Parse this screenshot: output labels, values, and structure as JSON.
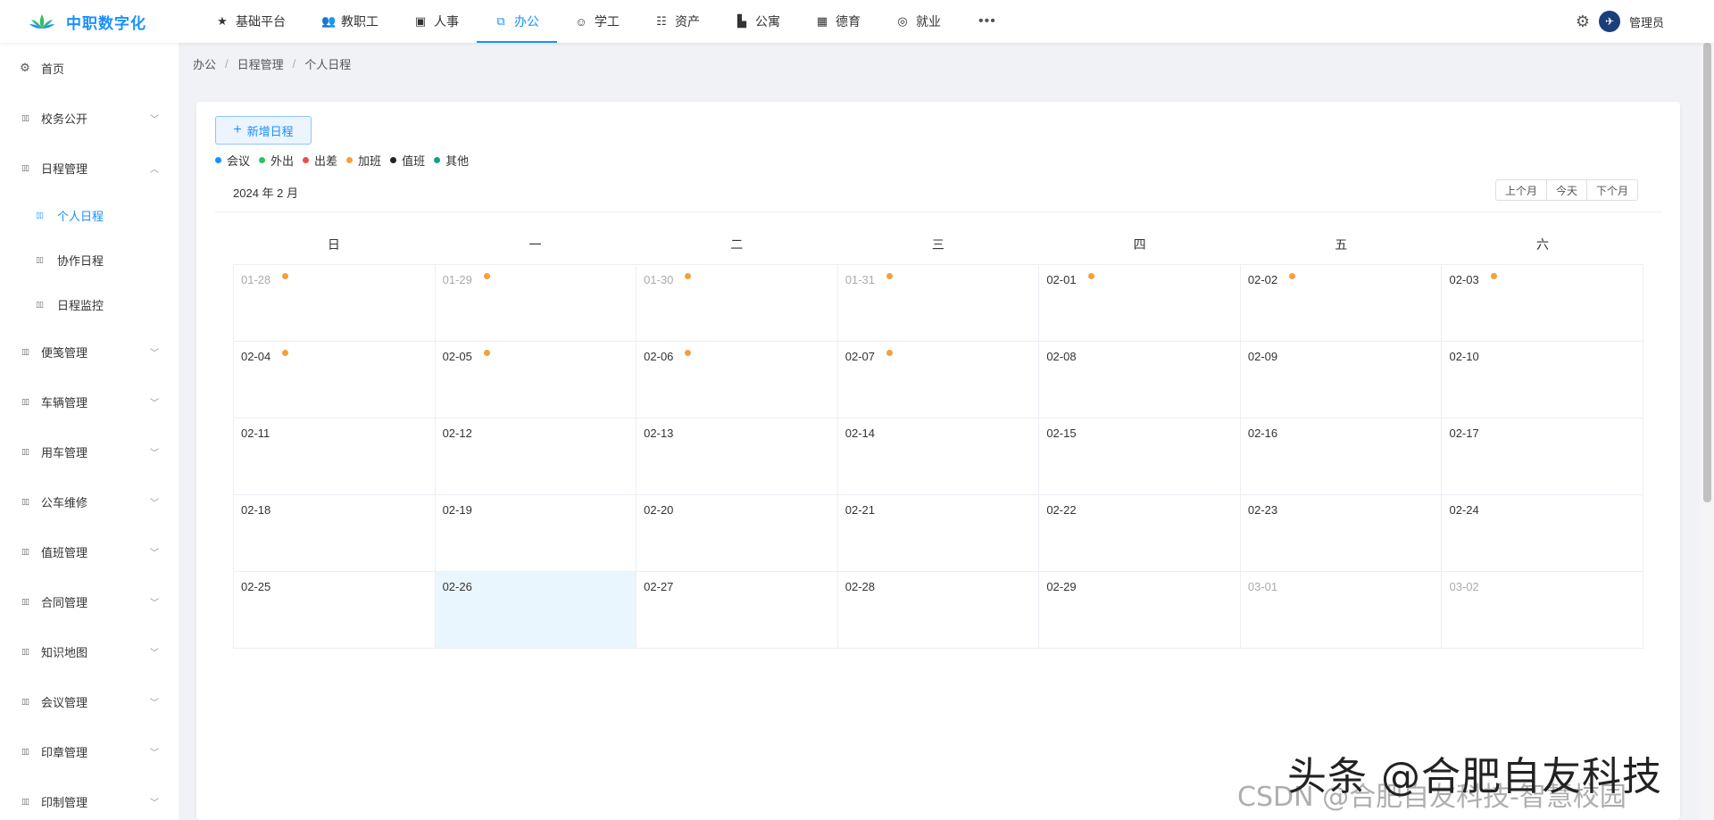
{
  "brand": {
    "name": "中职数字化"
  },
  "topnav": [
    {
      "label": "基础平台",
      "icon": "star-icon",
      "glyph": "★",
      "active": false
    },
    {
      "label": "教职工",
      "icon": "users-icon",
      "glyph": "👥",
      "active": false
    },
    {
      "label": "人事",
      "icon": "image-icon",
      "glyph": "▣",
      "active": false
    },
    {
      "label": "办公",
      "icon": "office-icon",
      "glyph": "⧉",
      "active": true
    },
    {
      "label": "学工",
      "icon": "student-icon",
      "glyph": "☺",
      "active": false
    },
    {
      "label": "资产",
      "icon": "asset-icon",
      "glyph": "☷",
      "active": false
    },
    {
      "label": "公寓",
      "icon": "apartment-icon",
      "glyph": "▙",
      "active": false
    },
    {
      "label": "德育",
      "icon": "calendar-grid-icon",
      "glyph": "▦",
      "active": false
    },
    {
      "label": "就业",
      "icon": "job-icon",
      "glyph": "◎",
      "active": false
    }
  ],
  "nav_more": "•••",
  "user": {
    "name": "管理员",
    "avatar_glyph": "✈"
  },
  "sidebar": {
    "home": {
      "label": "首页",
      "glyph": "⚙"
    },
    "items": [
      {
        "label": "校务公开",
        "expanded": false
      },
      {
        "label": "日程管理",
        "expanded": true,
        "children": [
          "个人日程",
          "协作日程",
          "日程监控"
        ]
      },
      {
        "label": "便笺管理",
        "expanded": false
      },
      {
        "label": "车辆管理",
        "expanded": false
      },
      {
        "label": "用车管理",
        "expanded": false
      },
      {
        "label": "公车维修",
        "expanded": false
      },
      {
        "label": "值班管理",
        "expanded": false
      },
      {
        "label": "合同管理",
        "expanded": false
      },
      {
        "label": "知识地图",
        "expanded": false
      },
      {
        "label": "会议管理",
        "expanded": false
      },
      {
        "label": "印章管理",
        "expanded": false
      },
      {
        "label": "印制管理",
        "expanded": false
      }
    ],
    "active_child": "个人日程"
  },
  "breadcrumb": [
    "办公",
    "日程管理",
    "个人日程"
  ],
  "add_button": "新增日程",
  "legend": [
    {
      "label": "会议",
      "color": "#1890ff"
    },
    {
      "label": "外出",
      "color": "#2fc25b"
    },
    {
      "label": "出差",
      "color": "#e8504c"
    },
    {
      "label": "加班",
      "color": "#f5a03a"
    },
    {
      "label": "值班",
      "color": "#222222"
    },
    {
      "label": "其他",
      "color": "#13a08a"
    }
  ],
  "calendar": {
    "title": "2024 年 2 月",
    "buttons": {
      "prev": "上个月",
      "today": "今天",
      "next": "下个月"
    },
    "weekdays": [
      "日",
      "一",
      "二",
      "三",
      "四",
      "五",
      "六"
    ],
    "event_color": "#f5a03a",
    "weeks": [
      [
        {
          "d": "01-28",
          "other": true,
          "ev": true
        },
        {
          "d": "01-29",
          "other": true,
          "ev": true
        },
        {
          "d": "01-30",
          "other": true,
          "ev": true
        },
        {
          "d": "01-31",
          "other": true,
          "ev": true
        },
        {
          "d": "02-01",
          "ev": true
        },
        {
          "d": "02-02",
          "ev": true
        },
        {
          "d": "02-03",
          "ev": true
        }
      ],
      [
        {
          "d": "02-04",
          "ev": true
        },
        {
          "d": "02-05",
          "ev": true
        },
        {
          "d": "02-06",
          "ev": true
        },
        {
          "d": "02-07",
          "ev": true
        },
        {
          "d": "02-08"
        },
        {
          "d": "02-09"
        },
        {
          "d": "02-10"
        }
      ],
      [
        {
          "d": "02-11"
        },
        {
          "d": "02-12"
        },
        {
          "d": "02-13"
        },
        {
          "d": "02-14"
        },
        {
          "d": "02-15"
        },
        {
          "d": "02-16"
        },
        {
          "d": "02-17"
        }
      ],
      [
        {
          "d": "02-18"
        },
        {
          "d": "02-19"
        },
        {
          "d": "02-20"
        },
        {
          "d": "02-21"
        },
        {
          "d": "02-22"
        },
        {
          "d": "02-23"
        },
        {
          "d": "02-24"
        }
      ],
      [
        {
          "d": "02-25"
        },
        {
          "d": "02-26",
          "today": true
        },
        {
          "d": "02-27"
        },
        {
          "d": "02-28"
        },
        {
          "d": "02-29"
        },
        {
          "d": "03-01",
          "other": true
        },
        {
          "d": "03-02",
          "other": true
        }
      ]
    ]
  },
  "watermark": {
    "top": "头条 @合肥自友科技",
    "bottom": "CSDN @合肥自友科技-智慧校园"
  }
}
